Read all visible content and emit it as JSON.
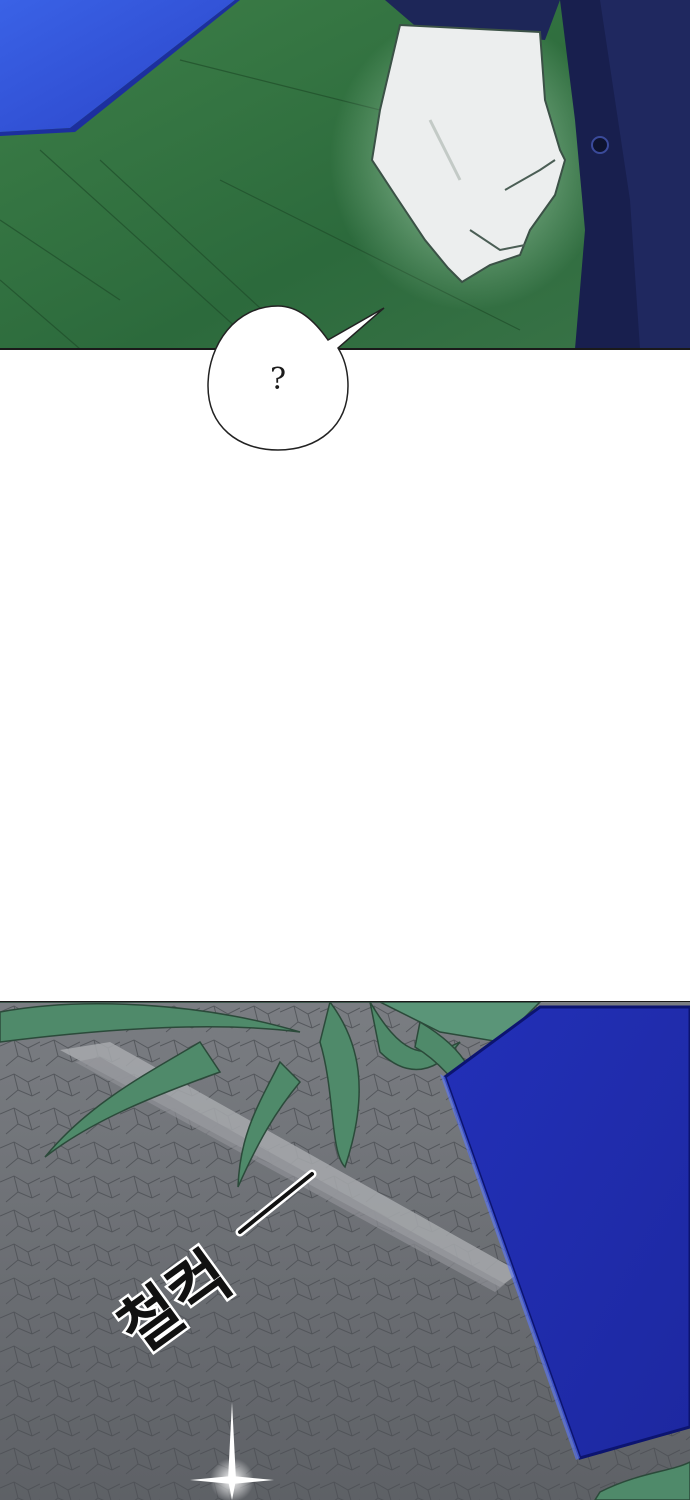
{
  "speech_bubble": {
    "text": "?"
  },
  "sound_effect": {
    "text": "철컥"
  },
  "colors": {
    "grass": "#2f6b3a",
    "blue_block": "#2b46c8",
    "sleeve": "#1d2658",
    "skin": "#e9ebea",
    "ground": "#6b6e72",
    "vines": "#4f8a6a",
    "background": "#ffffff"
  },
  "icons": [
    "speech-bubble",
    "sound-effect-lettering",
    "sparkle-icon"
  ]
}
